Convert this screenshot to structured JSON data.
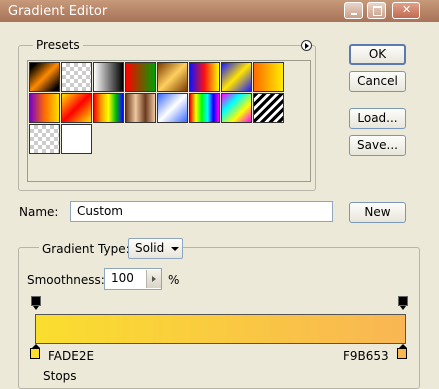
{
  "window": {
    "title": "Gradient Editor"
  },
  "presets": {
    "label": "Presets",
    "swatches": [
      "linear-gradient(135deg,#000 10%,#ff8a00 50%,#000 90%)",
      "repeating-conic-gradient(#ccc 0 25%,#fff 0 50%) 0 0/8px 8px",
      "linear-gradient(90deg,#fff,#000)",
      "linear-gradient(90deg,#ff0000,#00a000)",
      "linear-gradient(135deg,#7a3b00,#ffd060,#7a3b00)",
      "linear-gradient(90deg,#1010ff,#ff1010,#ffff00)",
      "linear-gradient(135deg,#1a1aff,#ffe400,#1a1aff)",
      "linear-gradient(90deg,#ff6a00,#ffee00)",
      "linear-gradient(90deg,#7a00c8,#ff6a00,#ffe000)",
      "linear-gradient(135deg,#ffe000,#ff0000,#ffe000)",
      "linear-gradient(90deg,#ff0000,#ffa000,#ffff00,#00c000,#0000ff)",
      "linear-gradient(90deg,#6b3a1e,#f0c8a0,#6b3a1e,#f0c8a0)",
      "linear-gradient(135deg,#3a6aff,#fff 50%,#3a6aff)",
      "linear-gradient(90deg,#ff0000,#ffff00,#00ff00,#00ffff,#0000ff,#ff00ff)",
      "linear-gradient(135deg,#ff00ff,#00ffff,#ffff00,#ff00ff)",
      "repeating-linear-gradient(135deg,#000 0 3px,#fff 3px 6px)",
      "repeating-conic-gradient(#ccc 0 25%,#fff 0 50%) 0 0/8px 8px",
      "#ffffff"
    ]
  },
  "buttons": {
    "ok": "OK",
    "cancel": "Cancel",
    "load": "Load...",
    "save": "Save...",
    "new": "New"
  },
  "name": {
    "label": "Name:",
    "value": "Custom"
  },
  "gradient": {
    "type_label": "Gradient Type:",
    "type_value": "Solid",
    "smoothness_label": "Smoothness:",
    "smoothness_value": "100",
    "smoothness_unit": "%",
    "color_left": "#FADE2E",
    "color_right": "#F9B653",
    "stop_left_label": "FADE2E",
    "stop_right_label": "F9B653",
    "stops_label": "Stops"
  }
}
